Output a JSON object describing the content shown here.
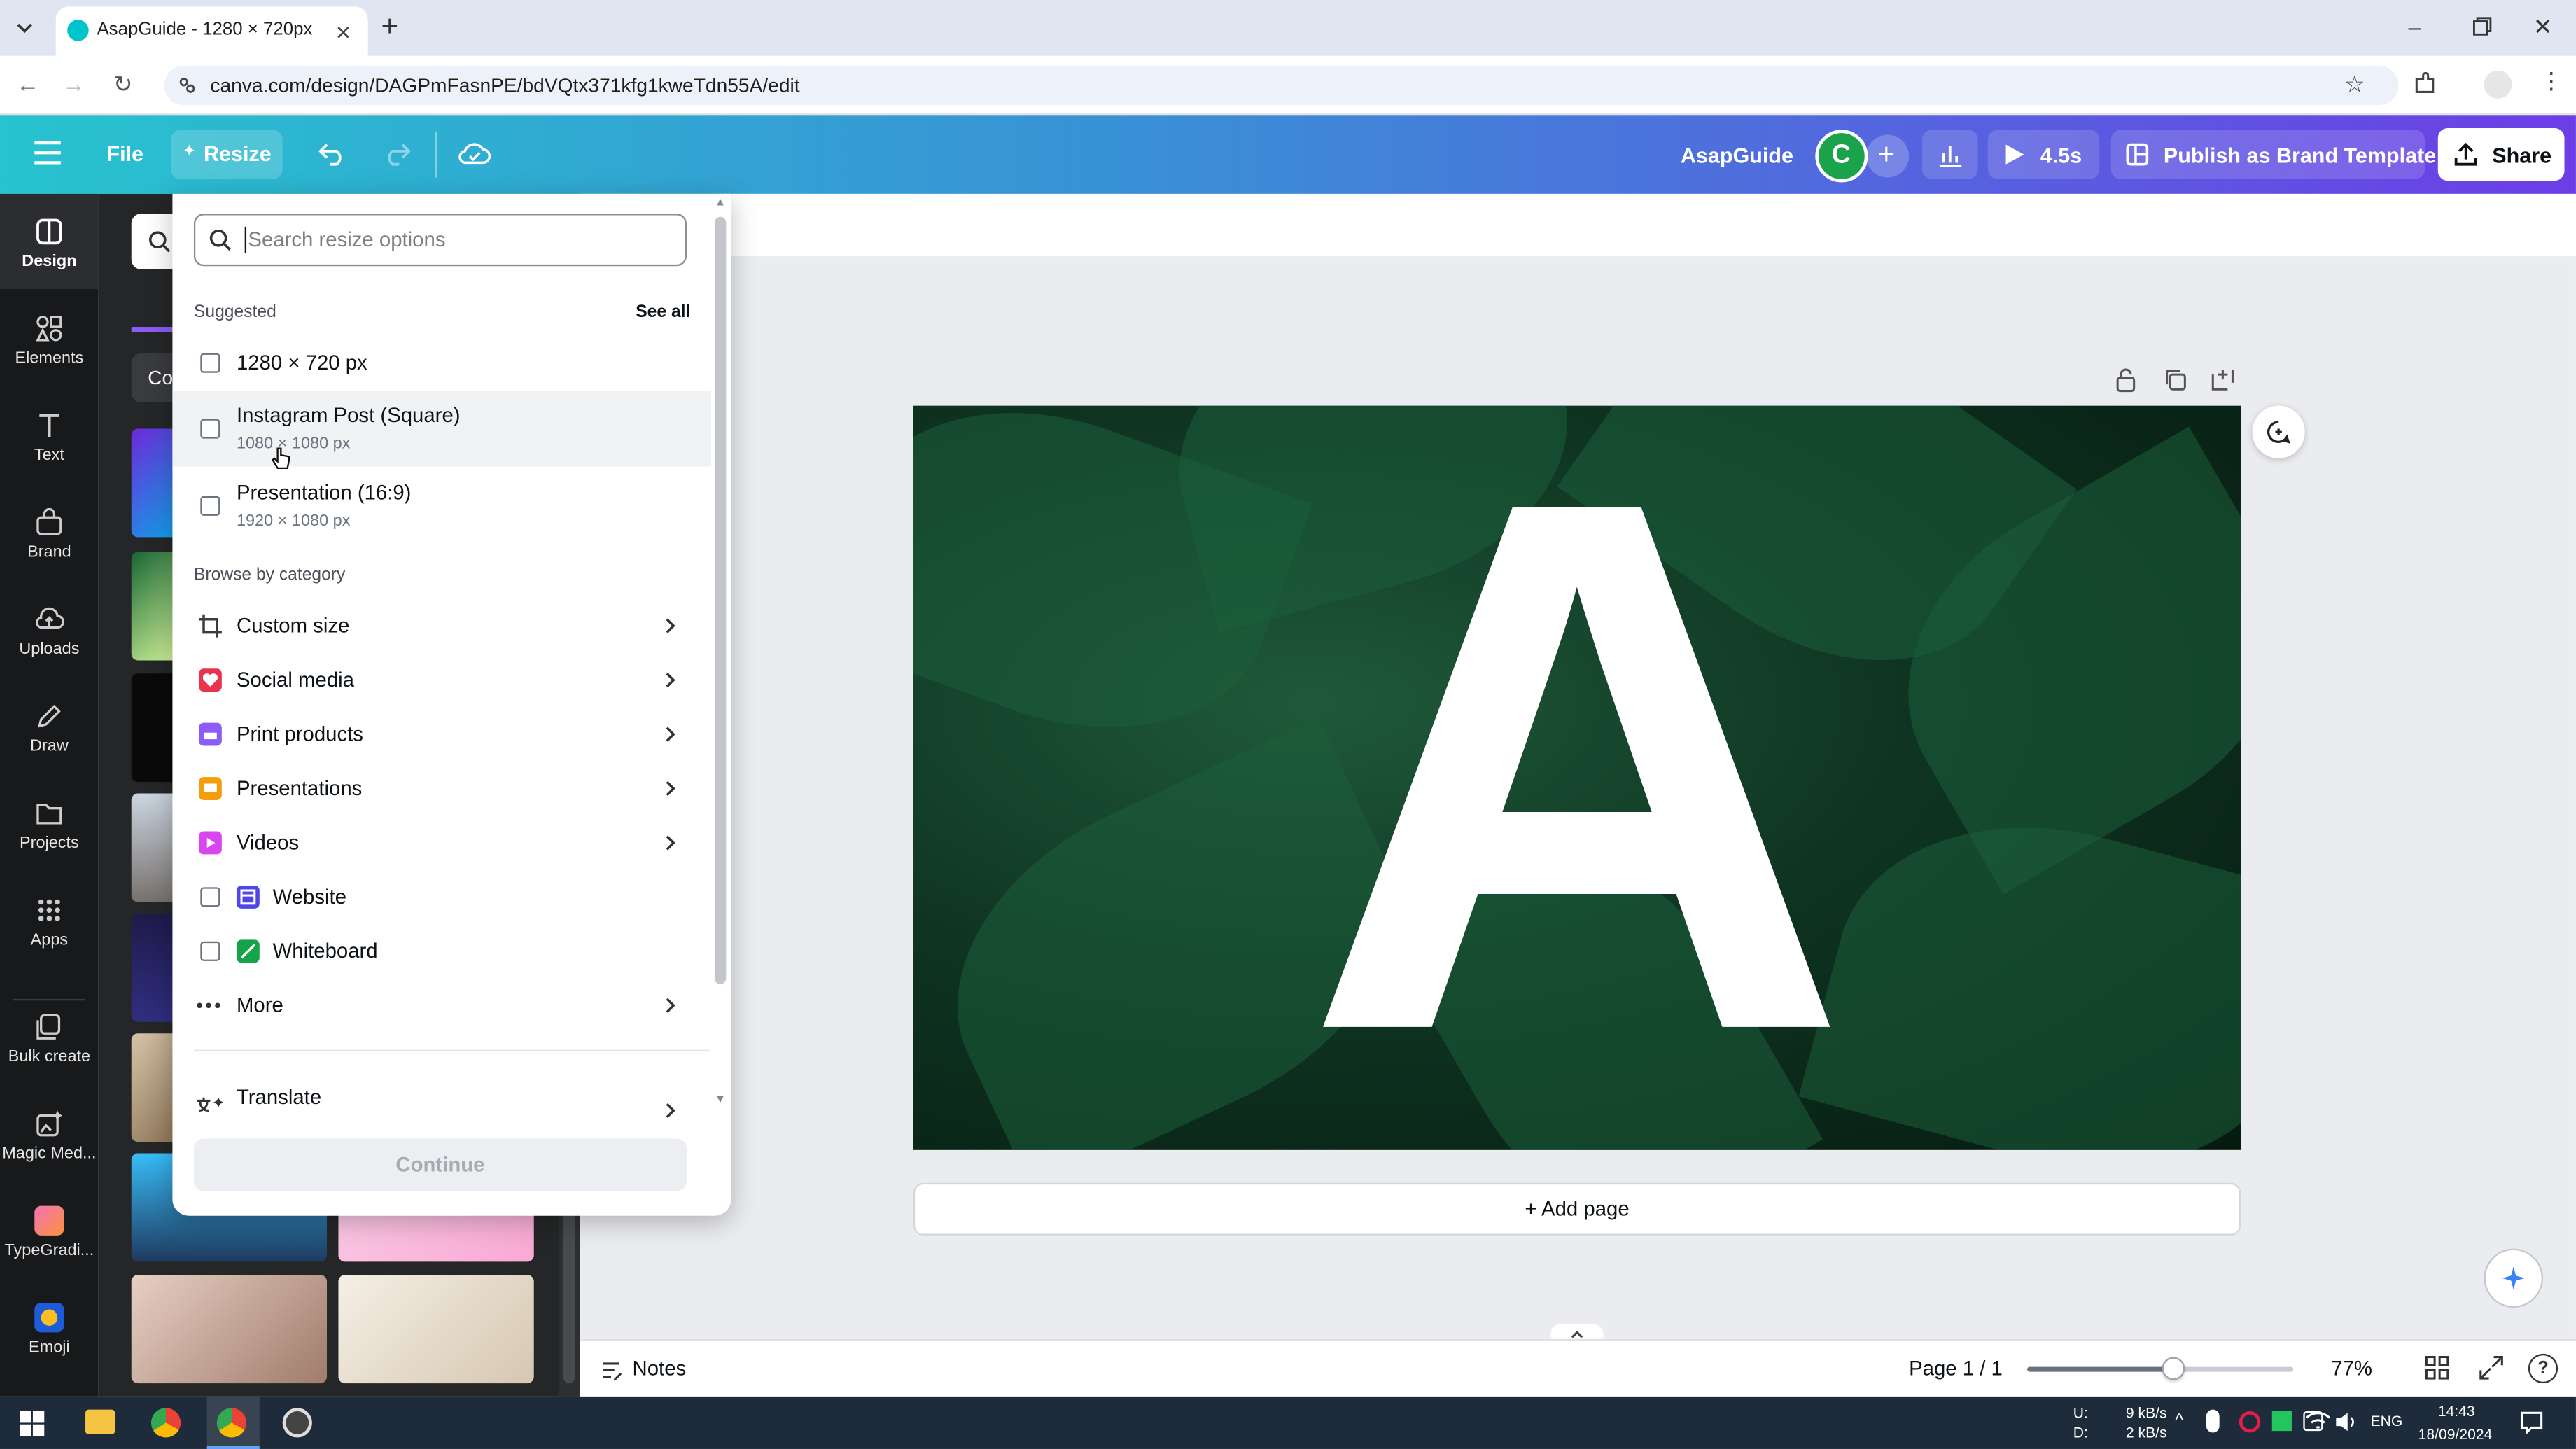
{
  "browser": {
    "tab_title": "AsapGuide - 1280 × 720px",
    "url": "canva.com/design/DAGPmFasnPE/bdVQtx371kfg1kweTdn55A/edit"
  },
  "header": {
    "file_label": "File",
    "resize_label": "Resize",
    "project_name": "AsapGuide",
    "avatar_letter": "C",
    "timer_label": "4.5s",
    "publish_label": "Publish as Brand Template",
    "share_label": "Share"
  },
  "rail": {
    "items": [
      {
        "label": "Design"
      },
      {
        "label": "Elements"
      },
      {
        "label": "Text"
      },
      {
        "label": "Brand"
      },
      {
        "label": "Uploads"
      },
      {
        "label": "Draw"
      },
      {
        "label": "Projects"
      },
      {
        "label": "Apps"
      },
      {
        "label": "Bulk create"
      },
      {
        "label": "Magic Med..."
      },
      {
        "label": "TypeGradi..."
      },
      {
        "label": "Emoji"
      }
    ]
  },
  "sidepanel": {
    "partial_label": "Co"
  },
  "resize_menu": {
    "search_placeholder": "Search resize options",
    "suggested_title": "Suggested",
    "see_all_label": "See all",
    "suggested": [
      {
        "label": "1280 × 720 px",
        "sub": ""
      },
      {
        "label": "Instagram Post (Square)",
        "sub": "1080 × 1080 px"
      },
      {
        "label": "Presentation (16:9)",
        "sub": "1920 × 1080 px"
      }
    ],
    "browse_title": "Browse by category",
    "categories": [
      {
        "label": "Custom size",
        "icon": "custom-size-icon",
        "color": "#3c3c3c"
      },
      {
        "label": "Social media",
        "icon": "heart-icon",
        "color": "#e8344f"
      },
      {
        "label": "Print products",
        "icon": "printer-icon",
        "color": "#8b5cf6"
      },
      {
        "label": "Presentations",
        "icon": "presentation-icon",
        "color": "#f59e0b"
      },
      {
        "label": "Videos",
        "icon": "video-icon",
        "color": "#d946ef"
      },
      {
        "label": "Website",
        "icon": "website-icon",
        "color": "#4f46e5"
      },
      {
        "label": "Whiteboard",
        "icon": "whiteboard-icon",
        "color": "#16a34a"
      },
      {
        "label": "More",
        "icon": "more-icon",
        "color": "#3c3c3c"
      }
    ],
    "translate_label": "Translate",
    "continue_label": "Continue"
  },
  "canvas": {
    "letter": "A",
    "add_page_label": "+ Add page"
  },
  "bottombar": {
    "notes_label": "Notes",
    "page_label": "Page 1 / 1",
    "zoom_label": "77%",
    "zoom_fraction": 0.55
  },
  "taskbar": {
    "net_up_label": "U:",
    "net_down_label": "D:",
    "net_up": "9 kB/s",
    "net_down": "2 kB/s",
    "lang": "ENG",
    "time": "14:43",
    "date": "18/09/2024"
  }
}
